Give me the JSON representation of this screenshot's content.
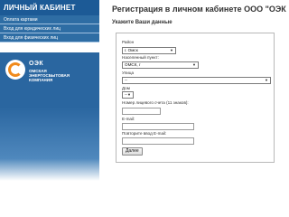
{
  "sidebar": {
    "header": "ЛИЧНЫЙ КАБИНЕТ",
    "items": [
      {
        "label": "Оплата картами"
      },
      {
        "label": "Вход для юридических лиц"
      },
      {
        "label": "Вход для физических лиц"
      }
    ],
    "logo": {
      "abbr": "ОЭК",
      "name": "ОМСКАЯ\nЭНЕРГОСБЫТОВАЯ\nКОМПАНИЯ"
    }
  },
  "main": {
    "title": "Регистрация в личном кабинете ООО \"ОЭК",
    "subtitle": "Укажите Ваши данные",
    "form": {
      "district_label": "Район",
      "district_value": "г. Омск",
      "locality_label": "Населенный пункт:",
      "locality_value": "ОМСК, г",
      "street_label": "Улица",
      "street_value": "--",
      "house_label": "Дом",
      "house_value": "--",
      "account_label": "Номер лицевого счета (11 знаков):",
      "email_label": "E-mail:",
      "email_repeat_label": "Повторите ввод E-mail:",
      "next_button": "Далее"
    }
  },
  "colors": {
    "header_blue": "#1c5a96",
    "menu_blue": "#2e6da4",
    "logo_orange": "#f08a1c"
  }
}
